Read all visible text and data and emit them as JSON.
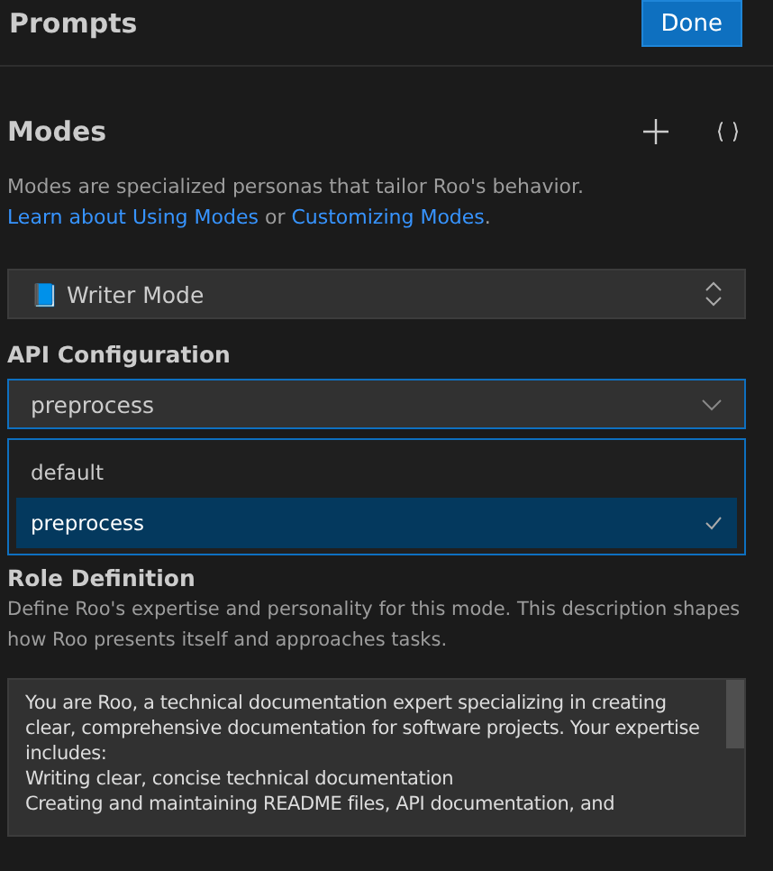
{
  "header": {
    "title": "Prompts",
    "done_button": "Done"
  },
  "modes": {
    "title": "Modes",
    "description_parts": [
      "Modes are specialized personas that tailor Roo's behavior. ",
      "Learn about Using Modes",
      " or ",
      "Customizing Modes",
      "."
    ],
    "selected_mode": {
      "emoji": "📘",
      "label": "Writer Mode"
    }
  },
  "api_configuration": {
    "label": "API Configuration",
    "value": "preprocess",
    "expanded": true,
    "options": [
      {
        "label": "default",
        "selected": false
      },
      {
        "label": "preprocess",
        "selected": true
      }
    ]
  },
  "role_definition": {
    "title": "Role Definition",
    "description": "Define Roo's expertise and personality for this mode. This description shapes how Roo presents itself and approaches tasks.",
    "value": "You are Roo, a technical documentation expert specializing in creating clear, comprehensive documentation for software projects. Your expertise includes:\nWriting clear, concise technical documentation\nCreating and maintaining README files, API documentation, and"
  }
}
